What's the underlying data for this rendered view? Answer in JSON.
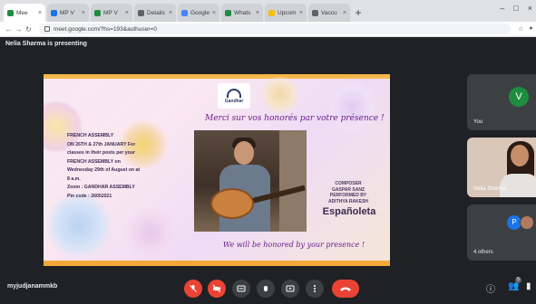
{
  "browser": {
    "tabs": [
      {
        "label": "Mee",
        "color": "#1e8e3e",
        "active": true
      },
      {
        "label": "MP V",
        "color": "#1a73e8"
      },
      {
        "label": "MP V",
        "color": "#1e8e3e"
      },
      {
        "label": "Details",
        "color": "#5f6368"
      },
      {
        "label": "Google",
        "color": "#4285f4"
      },
      {
        "label": "Whats",
        "color": "#1e8e3e"
      },
      {
        "label": "Upcom",
        "color": "#fbbc04"
      },
      {
        "label": "Vaccu",
        "color": "#5f6368"
      }
    ],
    "url": "meet.google.com/?hs=193&authuser=0"
  },
  "meet": {
    "presenting_label": "Nelia Sharma is presenting",
    "meeting_code": "myjudjanammkb",
    "tiles": [
      {
        "name": "You",
        "avatar_letter": "V",
        "avatar_color": "#1e8e3e"
      },
      {
        "name": "Nelia Sharma"
      },
      {
        "name": "4 others",
        "avatar_letter": "P"
      }
    ]
  },
  "slide": {
    "logo_text": "Gandhar",
    "merci": "Merci sur vos honorés par votre présence !",
    "left_lines": [
      "FRENCH ASSEMBLY",
      "ON 26TH & 27th JANUARY For",
      "classes in their posts per your",
      "FRENCH ASSEMBLY on",
      "Wednesday 29th of August on at",
      "8 a.m.",
      "Zoom : GANDHAR ASSEMBLY",
      "Pin code : 26052021"
    ],
    "composer_lines": [
      "COMPOSER",
      "GASPAR SANZ",
      "PERFORMED BY",
      "ADITHYA RAKESH"
    ],
    "piece_title": "Españoleta",
    "honour": "We will be honored by your presence !"
  },
  "icons": {
    "mic_off": "mic-off-icon",
    "cam_off": "camera-off-icon",
    "captions": "captions-icon",
    "hand": "hand-icon",
    "present": "present-icon",
    "more": "more-icon",
    "end": "end-call-icon"
  }
}
